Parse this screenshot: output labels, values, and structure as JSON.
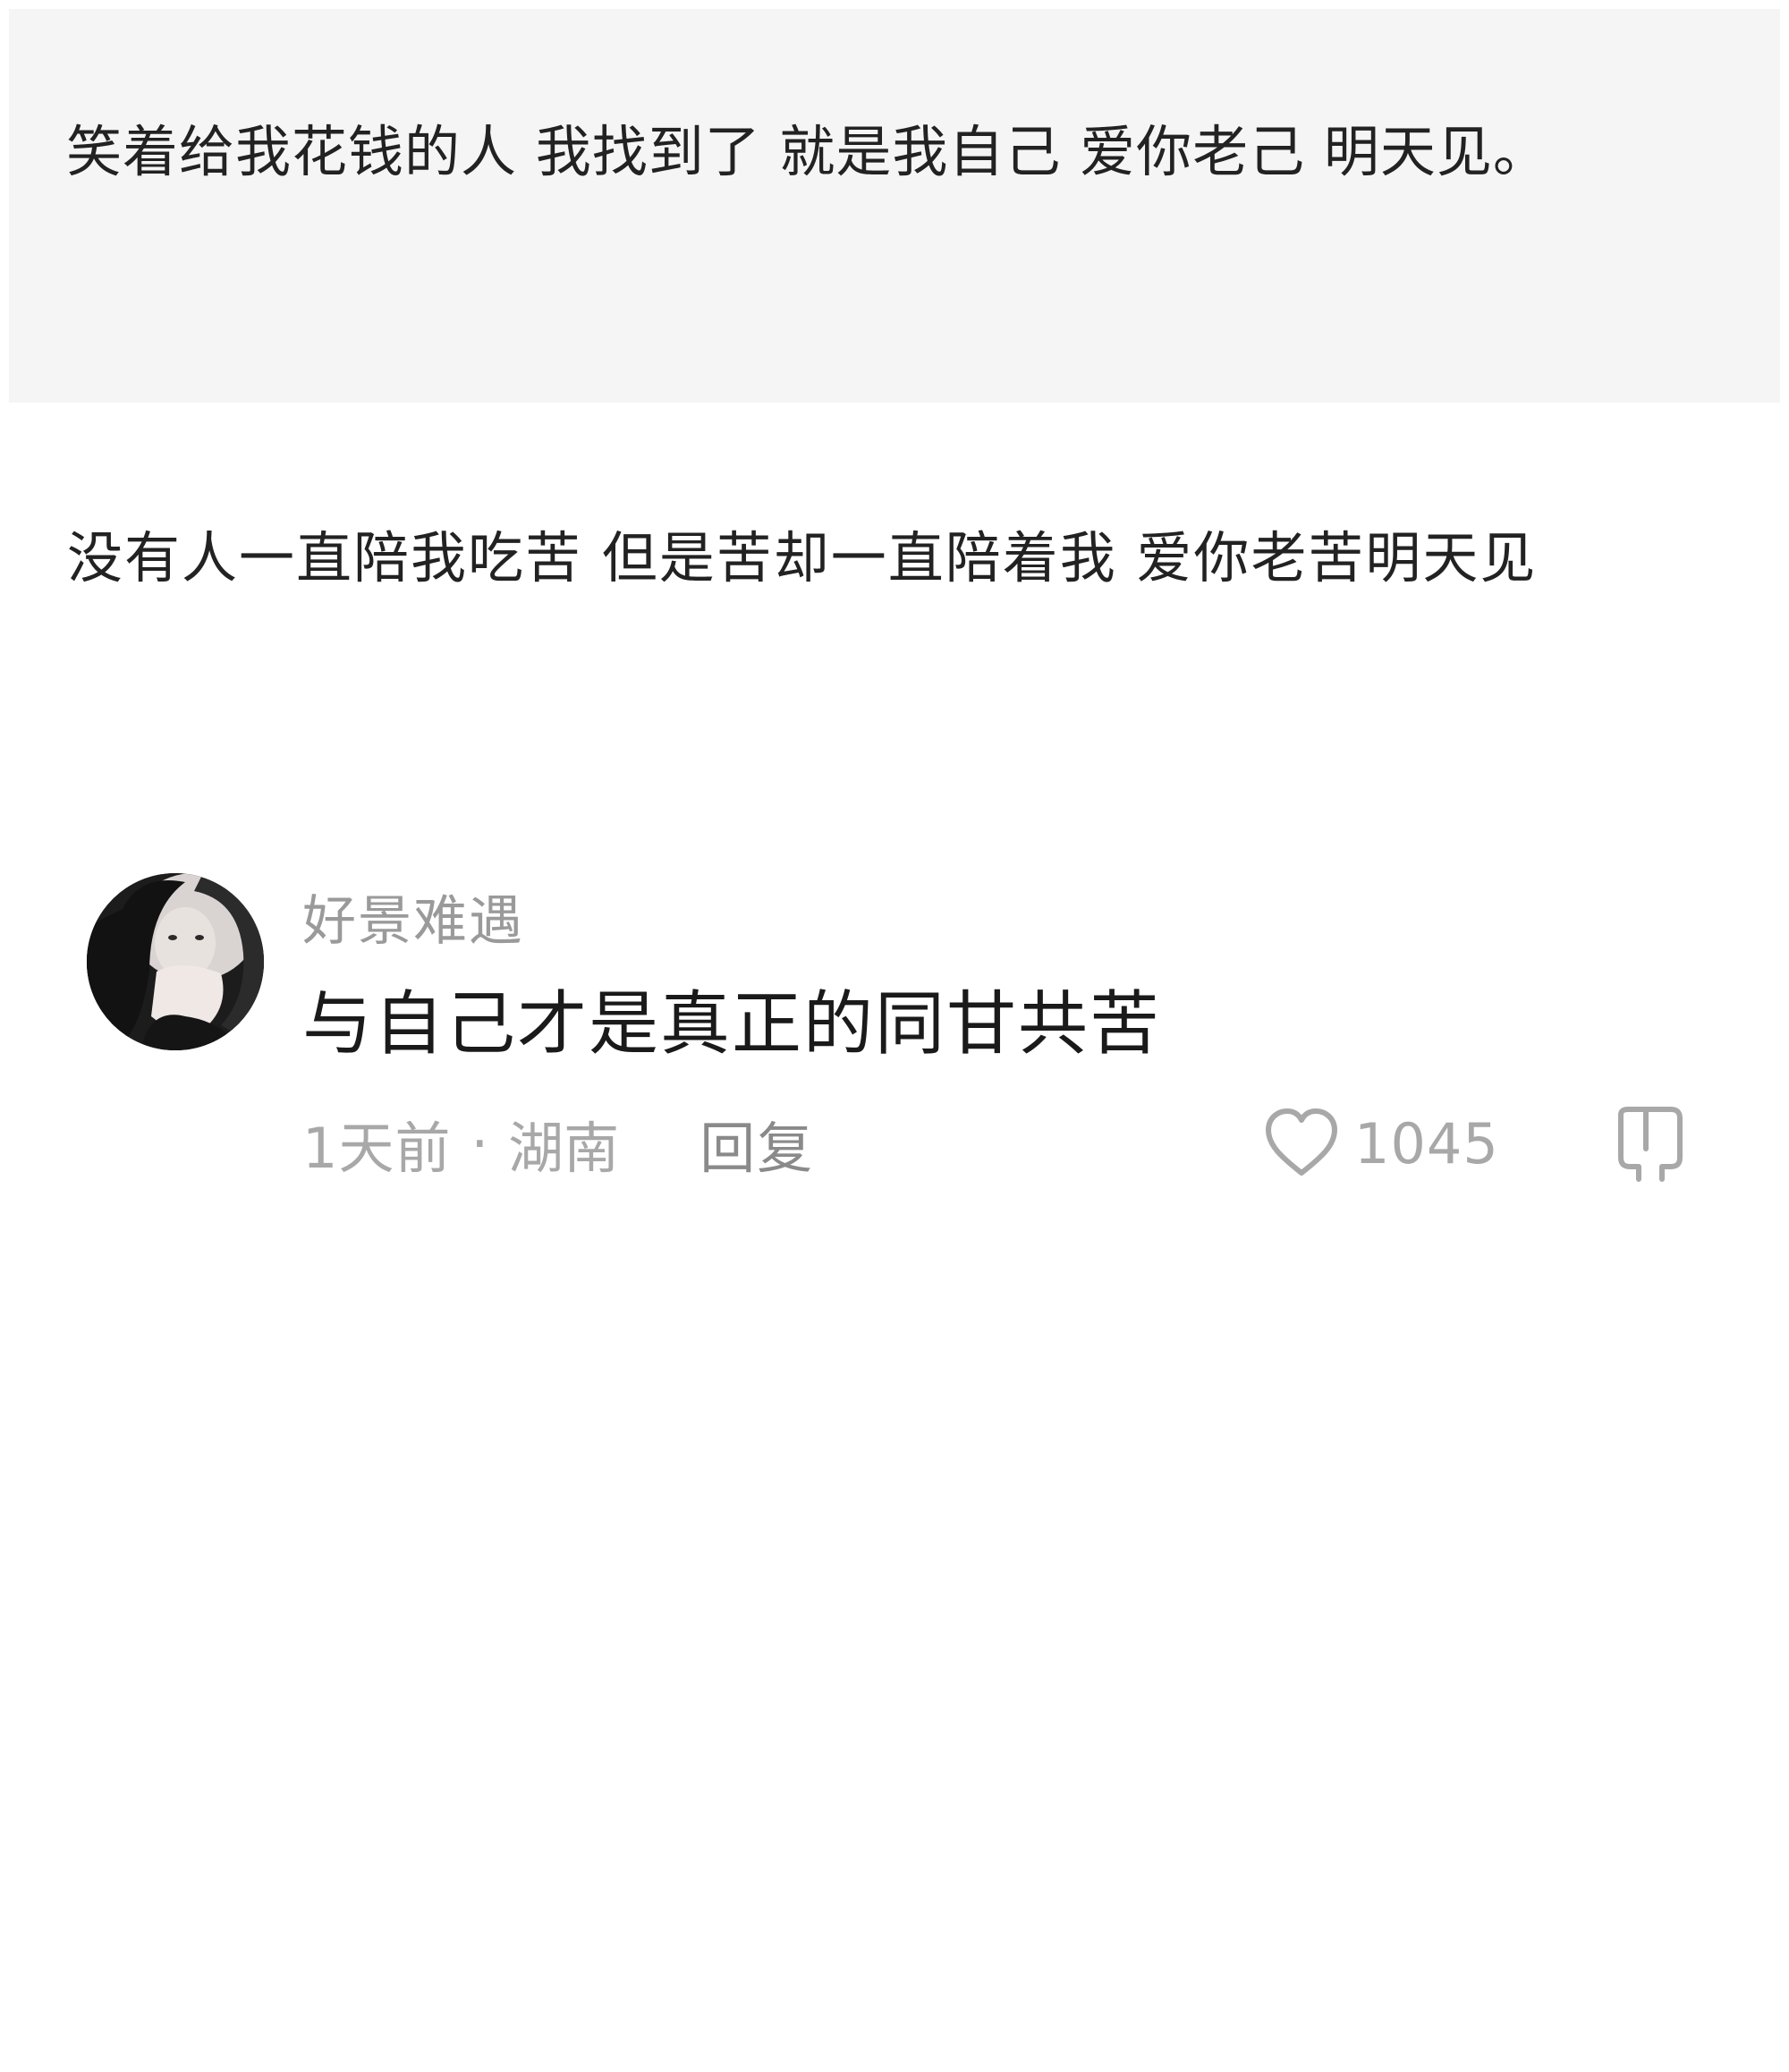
{
  "post1": {
    "text": "笑着给我花钱的人 我找到了 就是我自己 爱你老己 明天见。"
  },
  "post2": {
    "text": "没有人一直陪我吃苦 但是苦却一直陪着我 爱你老苦明天见"
  },
  "comment": {
    "username": "好景难遇",
    "text": "与自己才是真正的同甘共苦",
    "time": "1天前",
    "dot": "·",
    "location": "湖南",
    "reply_label": "回复",
    "like_count": "1045"
  },
  "icons": {
    "avatar": "avatar",
    "like": "heart-icon",
    "dislike": "thumb-down-icon"
  },
  "colors": {
    "post_background": "#f5f5f5",
    "meta_text": "#a8a8a8",
    "username": "#9a9a9a"
  }
}
